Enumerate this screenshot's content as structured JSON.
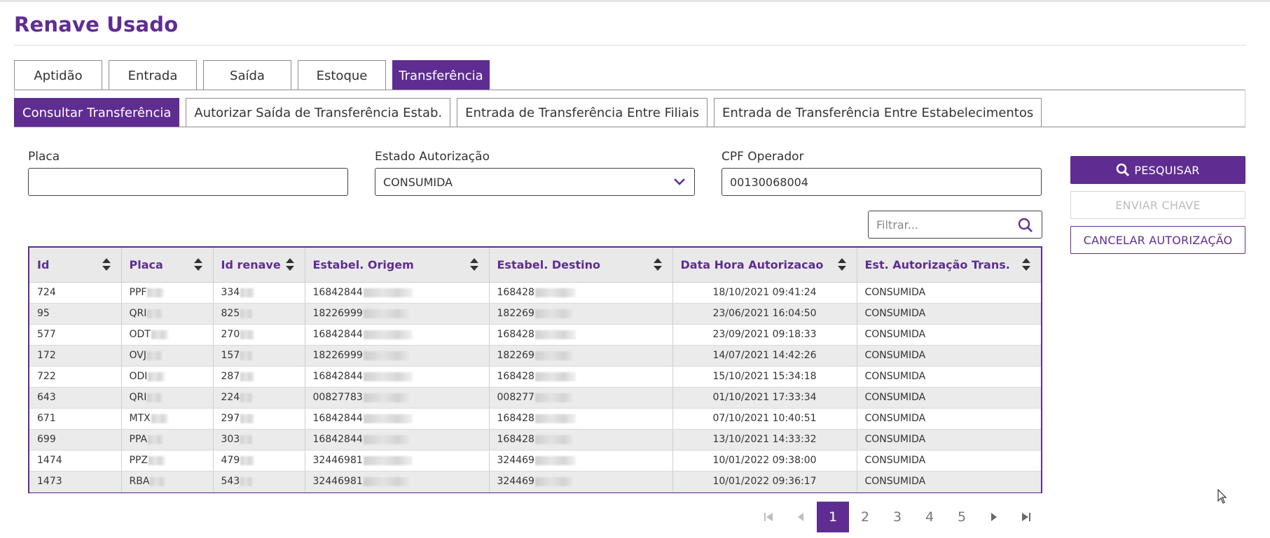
{
  "app": {
    "title": "Renave Usado"
  },
  "main_tabs": [
    {
      "label": "Aptidão",
      "active": false
    },
    {
      "label": "Entrada",
      "active": false
    },
    {
      "label": "Saída",
      "active": false
    },
    {
      "label": "Estoque",
      "active": false
    },
    {
      "label": "Transferência",
      "active": true
    }
  ],
  "sub_tabs": [
    {
      "label": "Consultar Transferência",
      "active": true
    },
    {
      "label": "Autorizar Saída de Transferência Estab.",
      "active": false
    },
    {
      "label": "Entrada de Transferência Entre Filiais",
      "active": false
    },
    {
      "label": "Entrada de Transferência Entre Estabelecimentos",
      "active": false
    }
  ],
  "form": {
    "placa": {
      "label": "Placa",
      "value": ""
    },
    "estado": {
      "label": "Estado Autorização",
      "value": "CONSUMIDA"
    },
    "cpf": {
      "label": "CPF Operador",
      "value": "00130068004"
    }
  },
  "actions": {
    "search": "PESQUISAR",
    "send_key": "ENVIAR CHAVE",
    "cancel": "CANCELAR AUTORIZAÇÃO"
  },
  "filter": {
    "placeholder": "Filtrar..."
  },
  "table": {
    "columns": [
      "Id",
      "Placa",
      "Id renave",
      "Estabel. Origem",
      "Estabel. Destino",
      "Data Hora Autorizacao",
      "Est. Autorização Trans."
    ],
    "rows": [
      {
        "id": "724",
        "placa": "PPF",
        "renave": "334",
        "origem": "16842844",
        "destino": "168428",
        "data": "18/10/2021 09:41:24",
        "estado": "CONSUMIDA"
      },
      {
        "id": "95",
        "placa": "QRI",
        "renave": "825",
        "origem": "18226999",
        "destino": "182269",
        "data": "23/06/2021 16:04:50",
        "estado": "CONSUMIDA"
      },
      {
        "id": "577",
        "placa": "ODT",
        "renave": "270",
        "origem": "16842844",
        "destino": "168428",
        "data": "23/09/2021 09:18:33",
        "estado": "CONSUMIDA"
      },
      {
        "id": "172",
        "placa": "OVJ",
        "renave": "157",
        "origem": "18226999",
        "destino": "182269",
        "data": "14/07/2021 14:42:26",
        "estado": "CONSUMIDA"
      },
      {
        "id": "722",
        "placa": "ODI",
        "renave": "287",
        "origem": "16842844",
        "destino": "168428",
        "data": "15/10/2021 15:34:18",
        "estado": "CONSUMIDA"
      },
      {
        "id": "643",
        "placa": "QRI",
        "renave": "224",
        "origem": "00827783",
        "destino": "008277",
        "data": "01/10/2021 17:33:34",
        "estado": "CONSUMIDA"
      },
      {
        "id": "671",
        "placa": "MTX",
        "renave": "297",
        "origem": "16842844",
        "destino": "168428",
        "data": "07/10/2021 10:40:51",
        "estado": "CONSUMIDA"
      },
      {
        "id": "699",
        "placa": "PPA",
        "renave": "303",
        "origem": "16842844",
        "destino": "168428",
        "data": "13/10/2021 14:33:32",
        "estado": "CONSUMIDA"
      },
      {
        "id": "1474",
        "placa": "PPZ",
        "renave": "479",
        "origem": "32446981",
        "destino": "324469",
        "data": "10/01/2022 09:38:00",
        "estado": "CONSUMIDA"
      },
      {
        "id": "1473",
        "placa": "RBA",
        "renave": "543",
        "origem": "32446981",
        "destino": "324469",
        "data": "10/01/2022 09:36:17",
        "estado": "CONSUMIDA"
      }
    ]
  },
  "pagination": {
    "pages": [
      "1",
      "2",
      "3",
      "4",
      "5"
    ],
    "current": "1"
  },
  "colors": {
    "accent": "#5f2d91"
  }
}
